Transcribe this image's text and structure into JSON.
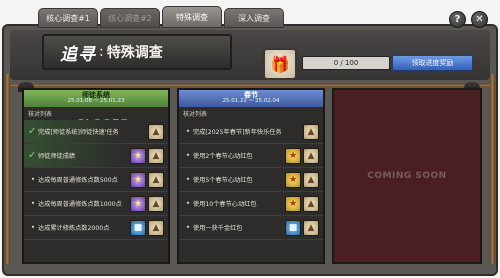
{
  "tabs": [
    {
      "label": "核心调查#1",
      "state": "normal"
    },
    {
      "label": "核心调查#2",
      "state": "dim"
    },
    {
      "label": "特殊调查",
      "state": "active"
    },
    {
      "label": "深入调查",
      "state": "normal"
    }
  ],
  "top_buttons": {
    "help": "?",
    "close": "✕"
  },
  "header": {
    "title_main": "追寻",
    "title_sep": ":",
    "title_sub": "特殊调查",
    "progress_text": "0 / 100",
    "progress_fraction": 0,
    "claim_label": "领取进度奖励"
  },
  "panel_left": {
    "name": "师徒系统",
    "date": "25.01.08 ~ 25.01.23",
    "list_label": "核对列表",
    "closed_label": "CLOSED",
    "rows": [
      {
        "status": "done",
        "text": "完成[师徒系统]师徒快速'任务",
        "icon": "cake-icon"
      },
      {
        "status": "done",
        "text": "师徒师徒成绩",
        "icon": "purple-item-icon"
      },
      {
        "status": "open",
        "text": "达成每周普通修炼点数500点",
        "icon": "purple-item-icon"
      },
      {
        "status": "open",
        "text": "达成每周普通修炼点数1000点",
        "icon": "purple-item-icon"
      },
      {
        "status": "open",
        "text": "达成累计修炼点数2000点",
        "icon": "gift-icon"
      }
    ]
  },
  "panel_middle": {
    "name": "春节",
    "date": "25.01.22 ~ 25.02.04",
    "list_label": "核对列表",
    "rows": [
      {
        "text": "完成[2025年春节]新年快乐任务",
        "icon": "cake-icon"
      },
      {
        "text": "使用2个春节心动红包",
        "icon": "star-icon"
      },
      {
        "text": "使用5个春节心动红包",
        "icon": "star-icon"
      },
      {
        "text": "使用10个春节心动红包",
        "icon": "star-icon"
      },
      {
        "text": "使用一获千金红包",
        "icon": "gift-icon"
      }
    ]
  },
  "panel_right": {
    "label": "COMING SOON"
  }
}
